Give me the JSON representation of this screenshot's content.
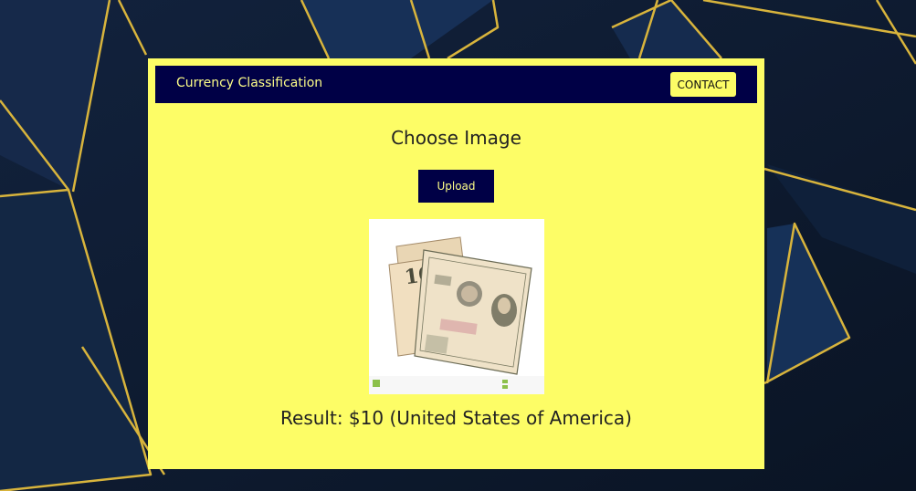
{
  "colors": {
    "navbar_bg": "#000046",
    "card_bg": "#fdfd66",
    "brand_text": "#fdfd88",
    "page_bg": "#0f1a2e",
    "accent_gold": "#d8b43c"
  },
  "navbar": {
    "brand": "Currency Classification",
    "contact_label": "CONTACT"
  },
  "main": {
    "heading": "Choose Image",
    "upload_label": "Upload",
    "result_label": "Result:",
    "result_value": "$10 (United States of America)"
  },
  "image": {
    "icon": "banknote-image",
    "note_value": "10"
  }
}
